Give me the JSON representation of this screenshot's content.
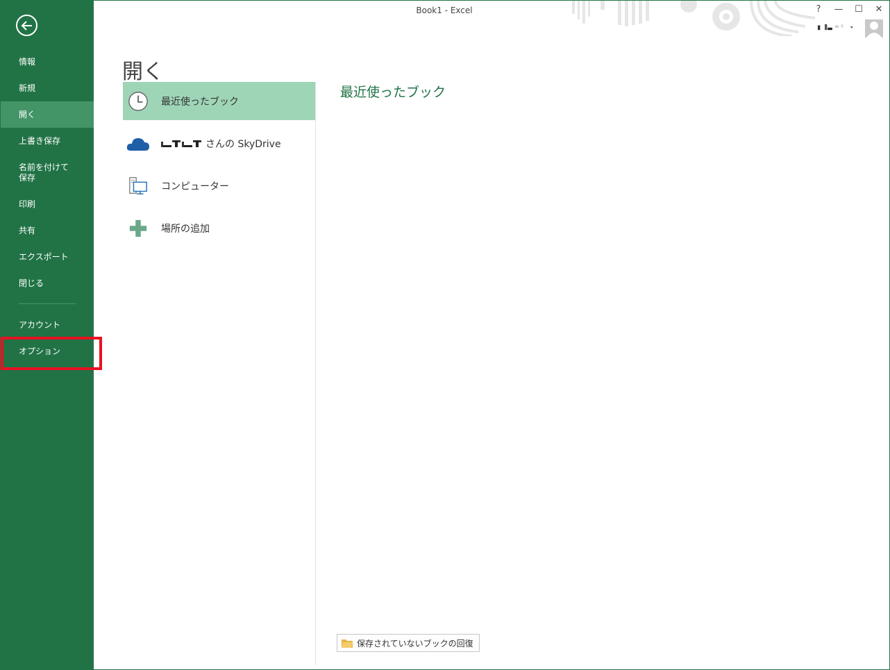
{
  "window": {
    "title": "Book1 - Excel",
    "help": "?",
    "minimize": "—",
    "maximize": "☐",
    "close": "✕"
  },
  "sidebar": {
    "items": [
      {
        "label": "情報"
      },
      {
        "label": "新規"
      },
      {
        "label": "開く"
      },
      {
        "label": "上書き保存"
      },
      {
        "label": "名前を付けて\n保存"
      },
      {
        "label": "印刷"
      },
      {
        "label": "共有"
      },
      {
        "label": "エクスポート"
      },
      {
        "label": "閉じる"
      },
      {
        "label": "アカウント"
      },
      {
        "label": "オプション"
      }
    ],
    "active_index": 2,
    "highlighted_item": "オプション"
  },
  "main": {
    "title": "開く",
    "places": [
      {
        "label": "最近使ったブック",
        "icon": "clock-icon"
      },
      {
        "label": "さんの SkyDrive",
        "icon": "cloud-icon"
      },
      {
        "label": "コンピューター",
        "icon": "computer-icon"
      },
      {
        "label": "場所の追加",
        "icon": "plus-icon"
      }
    ],
    "recent_title": "最近使ったブック",
    "recover_button": "保存されていないブックの回復"
  },
  "colors": {
    "accent": "#217346",
    "active_nav": "#439467",
    "active_place": "#9fd5b7",
    "highlight": "#e81123"
  }
}
